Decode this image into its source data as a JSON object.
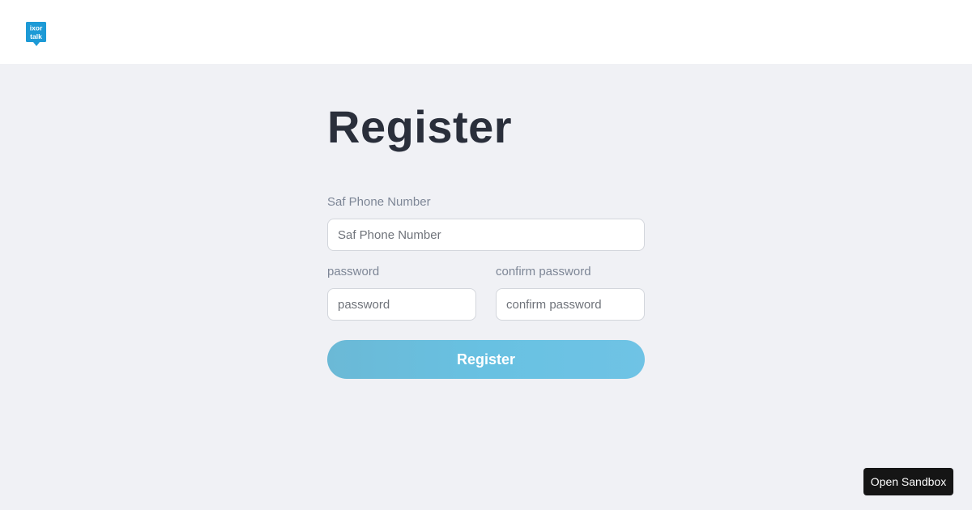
{
  "header": {
    "logo": {
      "icon": "ixortalk-logo",
      "line1": "ixor",
      "line2": "talk",
      "color": "#1d9ad6"
    }
  },
  "form": {
    "title": "Register",
    "phone": {
      "label": "Saf Phone Number",
      "placeholder": "Saf Phone Number",
      "value": ""
    },
    "password": {
      "label": "password",
      "placeholder": "password",
      "value": ""
    },
    "confirm_password": {
      "label": "confirm password",
      "placeholder": "confirm password",
      "value": ""
    },
    "submit_label": "Register",
    "submit_color": "#68c1e2"
  },
  "sandbox": {
    "label": "Open Sandbox"
  }
}
